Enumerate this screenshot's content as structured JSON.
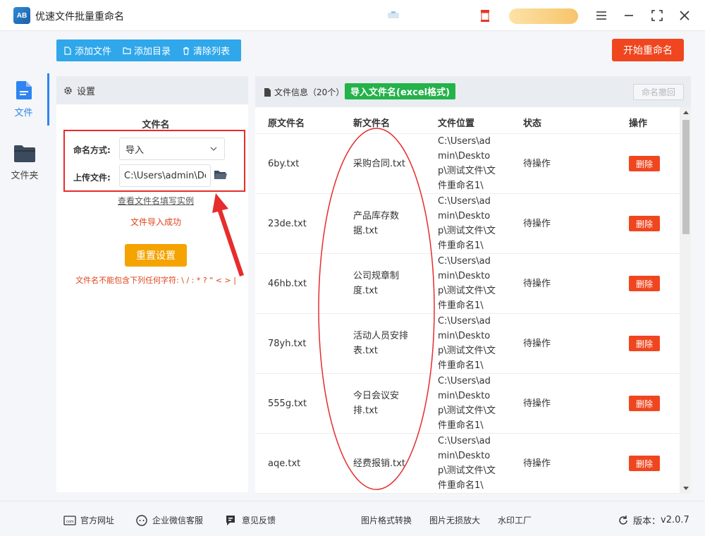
{
  "app": {
    "title": "优速文件批量重命名",
    "logo_text": "AB"
  },
  "sidebar": {
    "items": [
      {
        "label": "文件",
        "icon": "file-icon",
        "active": true
      },
      {
        "label": "文件夹",
        "icon": "folder-icon",
        "active": false
      }
    ]
  },
  "toolbar": {
    "add_file": "添加文件",
    "add_dir": "添加目录",
    "clear_list": "清除列表",
    "start": "开始重命名"
  },
  "settings": {
    "header": "设置",
    "section_title": "文件名",
    "naming_label": "命名方式:",
    "naming_value": "导入",
    "upload_label": "上传文件:",
    "upload_value": "C:\\Users\\admin\\Desktop",
    "example_link": "查看文件名填写实例",
    "import_status": "文件导入成功",
    "reset": "重置设置",
    "warning": "文件名不能包含下列任何字符: \\ / : * ? \" < > |"
  },
  "files": {
    "header": "文件信息（20个）",
    "import_excel": "导入文件名(excel格式)",
    "undo": "命名撤回",
    "columns": [
      "原文件名",
      "新文件名",
      "文件位置",
      "状态",
      "操作"
    ],
    "rows": [
      {
        "orig": "6by.txt",
        "new": "采购合同.txt",
        "loc": "C:\\Users\\admin\\Desktop\\测试文件\\文件重命名1\\",
        "status": "待操作",
        "action": "删除"
      },
      {
        "orig": "23de.txt",
        "new": "产品库存数据.txt",
        "loc": "C:\\Users\\admin\\Desktop\\测试文件\\文件重命名1\\",
        "status": "待操作",
        "action": "删除"
      },
      {
        "orig": "46hb.txt",
        "new": "公司规章制度.txt",
        "loc": "C:\\Users\\admin\\Desktop\\测试文件\\文件重命名1\\",
        "status": "待操作",
        "action": "删除"
      },
      {
        "orig": "78yh.txt",
        "new": "活动人员安排表.txt",
        "loc": "C:\\Users\\admin\\Desktop\\测试文件\\文件重命名1\\",
        "status": "待操作",
        "action": "删除"
      },
      {
        "orig": "555g.txt",
        "new": "今日会议安排.txt",
        "loc": "C:\\Users\\admin\\Desktop\\测试文件\\文件重命名1\\",
        "status": "待操作",
        "action": "删除"
      },
      {
        "orig": "aqe.txt",
        "new": "经费报销.txt",
        "loc": "C:\\Users\\admin\\Desktop\\测试文件\\文件重命名1\\",
        "status": "待操作",
        "action": "删除"
      }
    ]
  },
  "footer": {
    "website": "官方网址",
    "wechat": "企业微信客服",
    "feedback": "意见反馈",
    "format": "图片格式转换",
    "enlarge": "图片无损放大",
    "watermark": "水印工厂",
    "version_label": "版本：",
    "version": "v2.0.7"
  },
  "colors": {
    "primary": "#2fa7ea",
    "danger": "#f0461f",
    "success": "#24b24a",
    "warning": "#f5a300",
    "annotation": "#e62c2c"
  }
}
